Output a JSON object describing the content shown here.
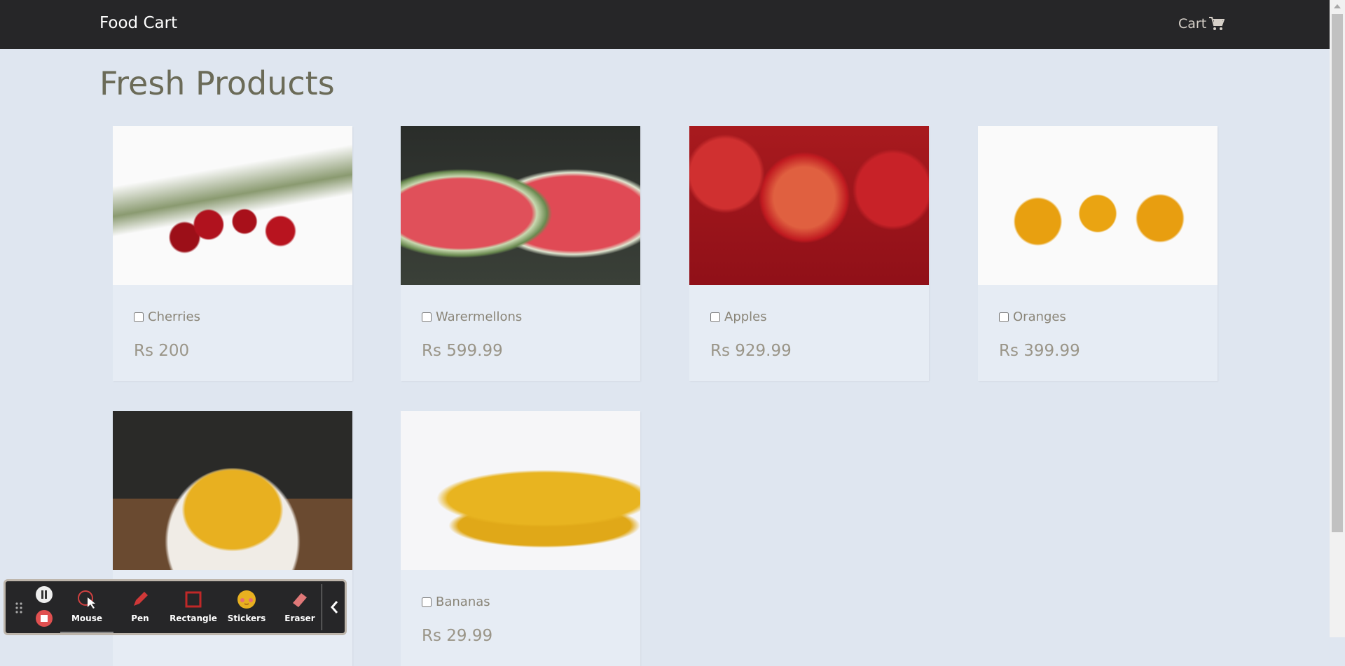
{
  "nav": {
    "brand": "Food Cart",
    "cart_label": "Cart"
  },
  "page_title": "Fresh Products",
  "products": [
    {
      "name": "Cherries",
      "price": "Rs 200"
    },
    {
      "name": "Warermellons",
      "price": "Rs 599.99"
    },
    {
      "name": "Apples",
      "price": "Rs 929.99"
    },
    {
      "name": "Oranges",
      "price": "Rs 399.99"
    },
    {
      "name": null,
      "price": null
    },
    {
      "name": "Bananas",
      "price": "Rs 29.99"
    }
  ],
  "toolbar": {
    "tools": [
      "Mouse",
      "Pen",
      "Rectangle",
      "Stickers",
      "Eraser"
    ]
  }
}
